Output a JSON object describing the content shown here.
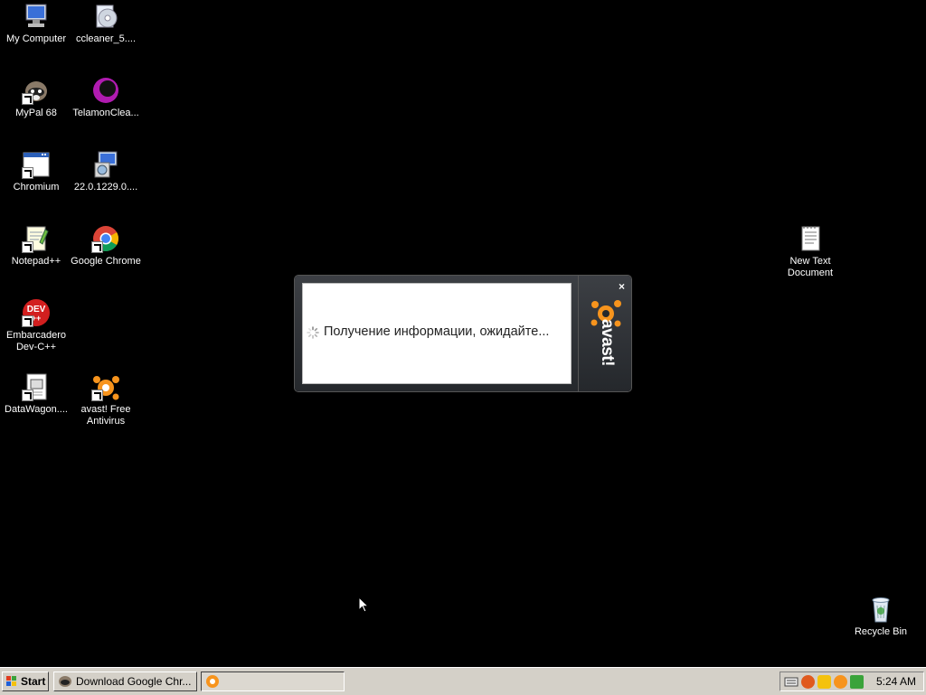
{
  "desktop_icons": [
    {
      "label": "My Computer",
      "icon": "computer-icon",
      "shortcut": false
    },
    {
      "label": "ccleaner_5....",
      "icon": "installer-icon",
      "shortcut": false
    },
    {
      "label": "MyPal 68",
      "icon": "mypal-icon",
      "shortcut": true
    },
    {
      "label": "TelamonClea...",
      "icon": "telamon-icon",
      "shortcut": false
    },
    {
      "label": "Chromium",
      "icon": "chromium-icon",
      "shortcut": true
    },
    {
      "label": "22.0.1229.0....",
      "icon": "setup-icon",
      "shortcut": false
    },
    {
      "label": "Notepad++",
      "icon": "notepadpp-icon",
      "shortcut": true
    },
    {
      "label": "Google Chrome",
      "icon": "chrome-icon",
      "shortcut": true
    },
    {
      "label": "Embarcadero Dev-C++",
      "icon": "devcpp-icon",
      "shortcut": true
    },
    {
      "label": "DataWagon....",
      "icon": "document-icon",
      "shortcut": true
    },
    {
      "label": "avast! Free Antivirus",
      "icon": "avast-icon",
      "shortcut": true
    },
    {
      "label": "New Text Document",
      "icon": "text-document-icon",
      "shortcut": false
    },
    {
      "label": "Recycle Bin",
      "icon": "recycle-bin-icon",
      "shortcut": false
    }
  ],
  "popup": {
    "message": "Получение информации, ожидайте...",
    "brand": "avast!",
    "close": "×"
  },
  "taskbar": {
    "start_label": "Start",
    "tasks": [
      {
        "label": "Download Google Chr...",
        "active": false
      },
      {
        "label": "",
        "active": true
      }
    ],
    "clock": "5:24 AM"
  },
  "colors": {
    "desktop_bg": "#000000",
    "taskbar_bg": "#d4d0c8",
    "avast_orange": "#f7941d"
  }
}
